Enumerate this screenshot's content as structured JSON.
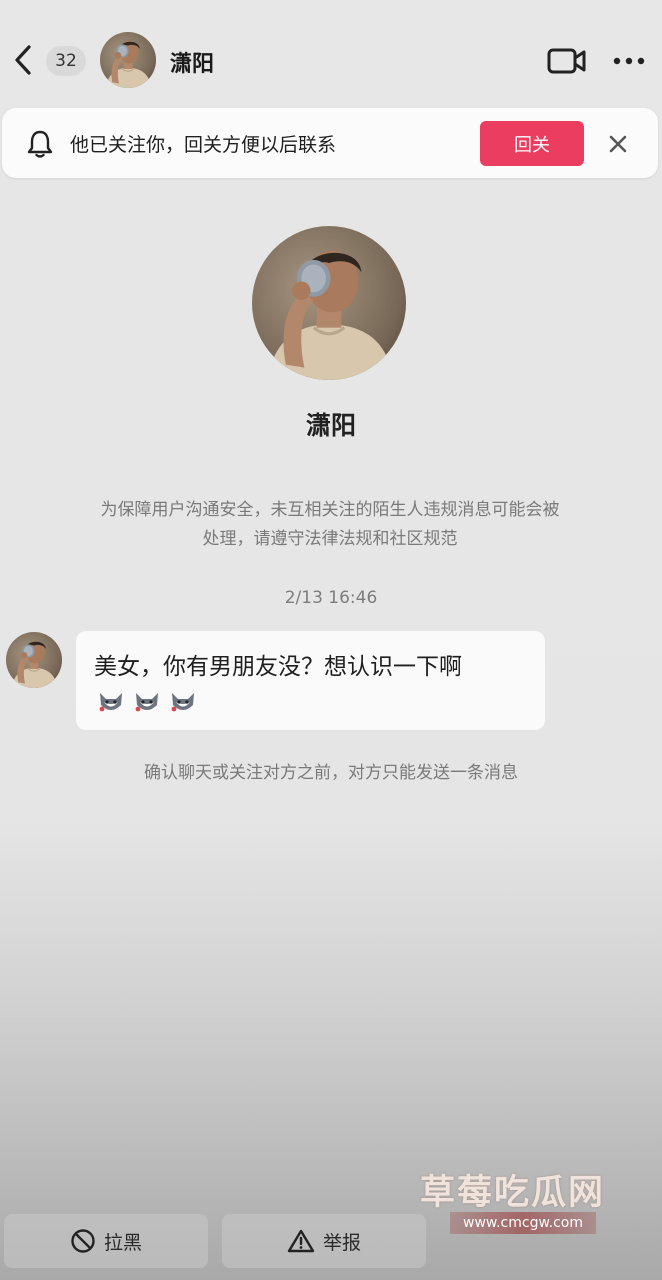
{
  "header": {
    "unread_count": "32",
    "contact_name": "潇阳"
  },
  "follow_banner": {
    "message": "他已关注你，回关方便以后联系",
    "follow_back_label": "回关"
  },
  "profile": {
    "name": "潇阳"
  },
  "safety_notice_line1": "为保障用户沟通安全，未互相关注的陌生人违规消息可能会被",
  "safety_notice_line2": "处理，请遵守法律法规和社区规范",
  "conversation": {
    "timestamp": "2/13 16:46",
    "message": {
      "text": "美女，你有男朋友没？想认识一下啊",
      "emojis": [
        "wolf-emoji",
        "wolf-emoji",
        "wolf-emoji"
      ]
    },
    "limit_notice": "确认聊天或关注对方之前，对方只能发送一条消息"
  },
  "bottom_actions": {
    "block_label": "拉黑",
    "report_label": "举报"
  },
  "watermark": {
    "title": "草莓吃瓜网",
    "url": "www.cmcgw.com"
  },
  "colors": {
    "accent": "#ea3d5f",
    "background": "#e6e6e6"
  }
}
